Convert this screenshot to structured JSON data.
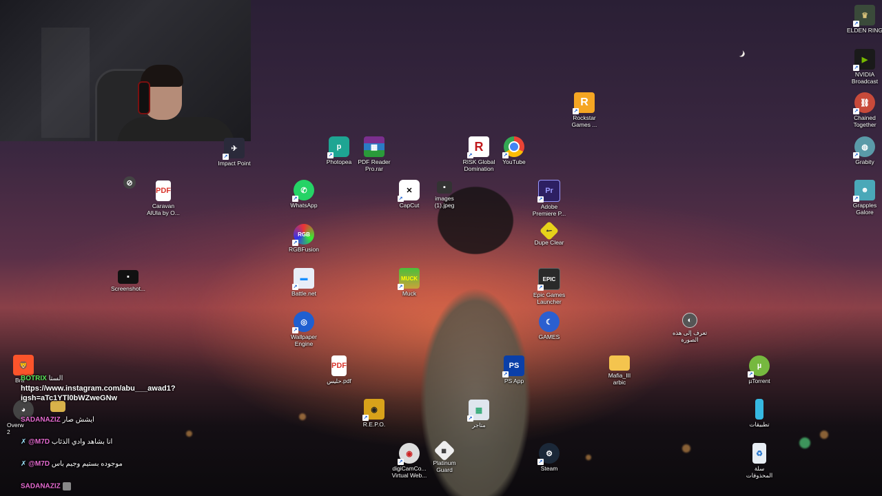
{
  "colors": {
    "whatsapp": "#25d366",
    "photopea": "#1ea593",
    "chrome_red": "#ea4335",
    "premiere": "#2d1f62",
    "epic": "#2a2a2a",
    "steam": "#1b2838",
    "utorrent": "#76b83f",
    "pdf": "#d9342b",
    "folder": "#f4c44e",
    "risk": "#c0181c",
    "rockstar": "#f5a623"
  },
  "desktop_icons": [
    {
      "id": "impact-point",
      "label": "Impact Point",
      "icon": "impact-point-icon"
    },
    {
      "id": "caravan",
      "label": "Caravan\nAlUla by O...",
      "icon": "pdf-file-icon"
    },
    {
      "id": "screenshot",
      "label": "Screenshot...",
      "icon": "image-file-icon"
    },
    {
      "id": "photopea",
      "label": "Photopea",
      "icon": "photopea-icon"
    },
    {
      "id": "pdf-reader",
      "label": "PDF Reader\nPro.rar",
      "icon": "winrar-archive-icon"
    },
    {
      "id": "whatsapp",
      "label": "WhatsApp",
      "icon": "whatsapp-icon"
    },
    {
      "id": "rgbfusion",
      "label": "RGBFusion",
      "icon": "rgb-fusion-icon"
    },
    {
      "id": "battlenet",
      "label": "Battle.net",
      "icon": "battle-net-icon"
    },
    {
      "id": "wallpaper-engine",
      "label": "Wallpaper\nEngine",
      "icon": "wallpaper-engine-icon"
    },
    {
      "id": "halees-pdf",
      "label": "حليس.pdf",
      "icon": "pdf-file-icon"
    },
    {
      "id": "repo",
      "label": "R.E.P.O.",
      "icon": "repo-game-icon"
    },
    {
      "id": "digicamcontrol",
      "label": "digiCamCo...\nVirtual Web...",
      "icon": "digicam-icon"
    },
    {
      "id": "platinum-guard",
      "label": "Platinum\nGuard",
      "icon": "platinum-guard-icon"
    },
    {
      "id": "capcut",
      "label": "CapCut",
      "icon": "capcut-icon"
    },
    {
      "id": "images-jpeg",
      "label": "images\n(1).jpeg",
      "icon": "image-file-icon"
    },
    {
      "id": "muck",
      "label": "Muck",
      "icon": "muck-icon"
    },
    {
      "id": "mataajir",
      "label": "متاجر",
      "icon": "store-icon"
    },
    {
      "id": "risk",
      "label": "RISK Global\nDomination",
      "icon": "risk-icon"
    },
    {
      "id": "youtube",
      "label": "YouTube",
      "icon": "chrome-icon"
    },
    {
      "id": "rockstar",
      "label": "Rockstar\nGames ...",
      "icon": "rockstar-icon"
    },
    {
      "id": "premiere",
      "label": "Adobe\nPremiere P...",
      "icon": "premiere-icon"
    },
    {
      "id": "dupe-clear",
      "label": "Dupe Clear",
      "icon": "dupe-clear-icon"
    },
    {
      "id": "epic",
      "label": "Epic Games\nLauncher",
      "icon": "epic-games-icon"
    },
    {
      "id": "games",
      "label": "GAMES",
      "icon": "games-folder-icon"
    },
    {
      "id": "ps-app",
      "label": "PS App",
      "icon": "playstation-icon"
    },
    {
      "id": "steam",
      "label": "Steam",
      "icon": "steam-icon"
    },
    {
      "id": "mafia",
      "label": "Mafia_III\narbic",
      "icon": "folder-icon"
    },
    {
      "id": "taarraf",
      "label": "تعرف إلى هذه\nالصورة",
      "icon": "learn-about-image-icon"
    },
    {
      "id": "utorrent",
      "label": "µTorrent",
      "icon": "utorrent-icon"
    },
    {
      "id": "tatbiqat",
      "label": "تطبيقات",
      "icon": "apps-folder-icon"
    },
    {
      "id": "recycle",
      "label": "سلة\nالمحذوفات",
      "icon": "recycle-bin-icon"
    },
    {
      "id": "elden-ring",
      "label": "ELDEN RING",
      "icon": "elden-ring-icon"
    },
    {
      "id": "nvidia",
      "label": "NVIDIA\nBroadcast",
      "icon": "nvidia-icon"
    },
    {
      "id": "chained",
      "label": "Chained\nTogether",
      "icon": "chained-together-icon"
    },
    {
      "id": "grabity",
      "label": "Grabity",
      "icon": "grabity-icon"
    },
    {
      "id": "grapples",
      "label": "Grapples\nGalore",
      "icon": "grapples-galore-icon"
    },
    {
      "id": "brave",
      "label": "Bra",
      "icon": "brave-icon"
    },
    {
      "id": "overwolf",
      "label": "Overw\n2",
      "icon": "overwolf-icon"
    }
  ],
  "chat": {
    "line1_user": "BOTRIX",
    "line1_prefix": "الستا",
    "line1_url": "https://www.instagram.com/abu___awad1?",
    "line1_url2": "igsh=aTc1YTl0bWZweGNw",
    "line2_user": "SADANAZIZ",
    "line2_text": "ايشش صار",
    "line3_user": "@M7D",
    "line3_text": "انا بشاهد وادي الذئاب",
    "line4_user": "@M7D",
    "line4_text": "موجوده بستيم وجيم باس",
    "line5_user": "SADANAZIZ"
  }
}
